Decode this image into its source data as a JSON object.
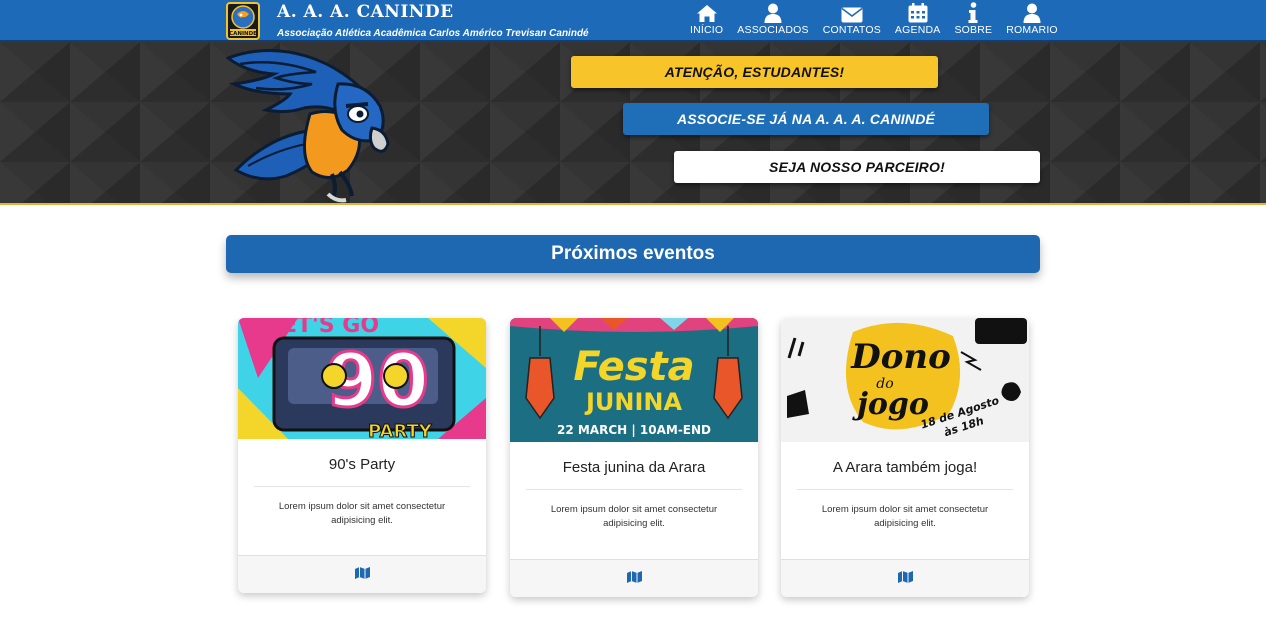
{
  "brand": {
    "title": "A. A. A. CANINDE",
    "subtitle": "Associação Atlética Acadêmica Carlos Américo Trevisan Canindé",
    "logo_label": "CANINDE"
  },
  "nav": [
    {
      "label": "INÍCIO",
      "icon": "home-icon"
    },
    {
      "label": "ASSOCIADOS",
      "icon": "user-icon"
    },
    {
      "label": "CONTATOS",
      "icon": "envelope-icon"
    },
    {
      "label": "AGENDA",
      "icon": "calendar-icon"
    },
    {
      "label": "SOBRE",
      "icon": "info-icon"
    },
    {
      "label": "ROMARIO",
      "icon": "user-icon"
    }
  ],
  "hero": {
    "btn_attention": "ATENÇÃO, ESTUDANTES!",
    "btn_associate": "ASSOCIE-SE JÁ NA A. A. A. CANINDÉ",
    "btn_partner": "SEJA NOSSO PARCEIRO!"
  },
  "events_title": "Próximos eventos",
  "cards": [
    {
      "title": "90's Party",
      "text": "Lorem ipsum dolor sit amet consectetur adipisicing elit.",
      "image": {
        "top_text": "LET'S GO",
        "big_text": "90",
        "bottom_text": "PARTY"
      },
      "footer_icon": "map-icon"
    },
    {
      "title": "Festa junina da Arara",
      "text": "Lorem ipsum dolor sit amet consectetur adipisicing elit.",
      "image": {
        "line1": "Festa",
        "line2": "JUNINA",
        "line3": "22 MARCH | 10AM-END"
      },
      "footer_icon": "map-icon"
    },
    {
      "title": "A Arara também joga!",
      "text": "Lorem ipsum dolor sit amet consectetur adipisicing elit.",
      "image": {
        "line1": "Dono",
        "line2": "do",
        "line3": "jogo",
        "line4": "18 de Agosto",
        "line5": "às 18h"
      },
      "footer_icon": "map-icon"
    }
  ],
  "colors": {
    "nav_blue": "#1d6ab8",
    "accent_yellow": "#f7c42a",
    "hero_dark": "#2f2f2f",
    "title_blue": "#1d68b0"
  }
}
